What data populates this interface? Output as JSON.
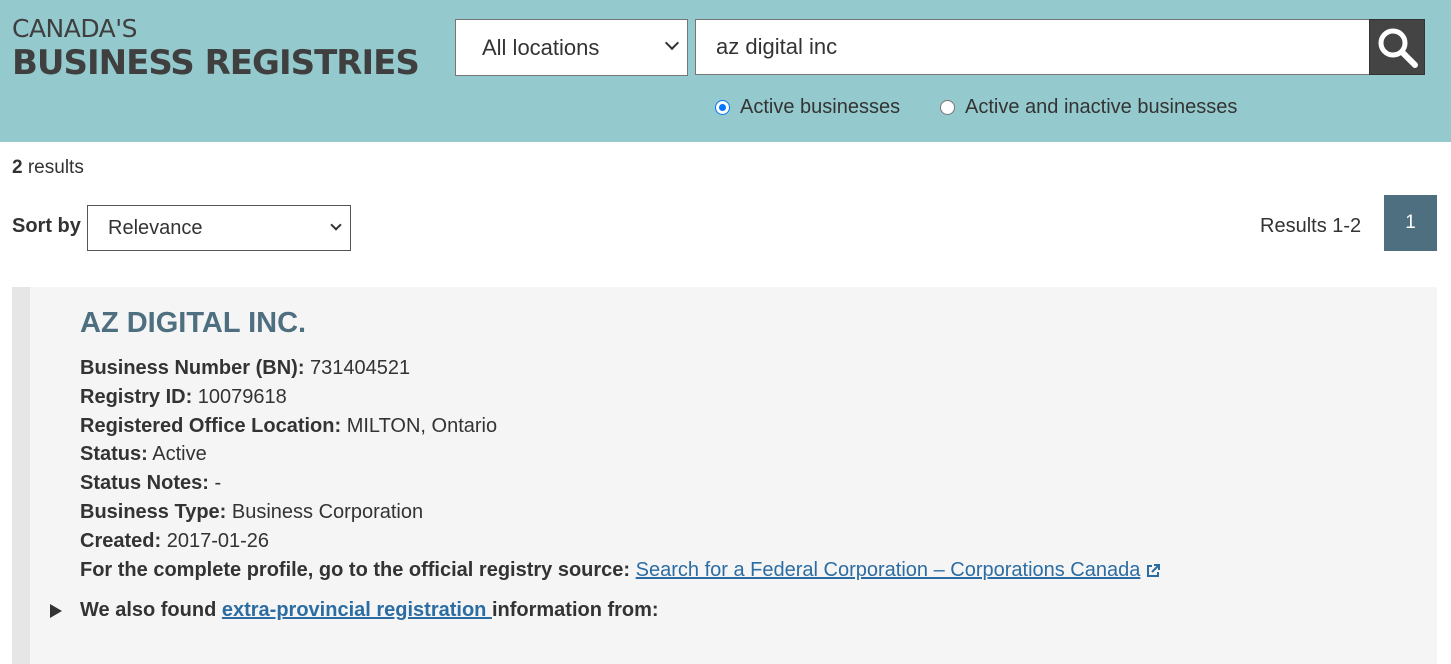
{
  "logo": {
    "line1": "CANADA'S",
    "line2": "BUSINESS REGISTRIES"
  },
  "search": {
    "location_selected": "All locations",
    "query": "az digital inc",
    "icon": "search-icon",
    "radio_active": "Active businesses",
    "radio_all": "Active and inactive businesses",
    "selected_radio": "Active businesses"
  },
  "results": {
    "count": "2",
    "count_label": " results",
    "sort_label": "Sort by",
    "sort_selected": "Relevance",
    "range": "Results 1-2",
    "page": "1"
  },
  "business": {
    "name": "AZ DIGITAL INC.",
    "fields": [
      {
        "label": "Business Number (BN):",
        "value": " 731404521"
      },
      {
        "label": "Registry ID:",
        "value": " 10079618"
      },
      {
        "label": "Registered Office Location:",
        "value": " MILTON, Ontario"
      },
      {
        "label": "Status:",
        "value": " Active"
      },
      {
        "label": "Status Notes:",
        "value": " -"
      },
      {
        "label": "Business Type:",
        "value": " Business Corporation"
      },
      {
        "label": "Created:",
        "value": " 2017-01-26"
      }
    ],
    "profile_label": "For the complete profile, go to the official registry source:",
    "profile_link": "Search for a Federal Corporation – Corporations Canada",
    "also_prefix": "We also found ",
    "also_link": "extra-provincial registration ",
    "also_suffix": "information from:"
  },
  "colors": {
    "header_bg": "#94cace",
    "accent": "#4e6f80",
    "link": "#2b6ca3"
  }
}
